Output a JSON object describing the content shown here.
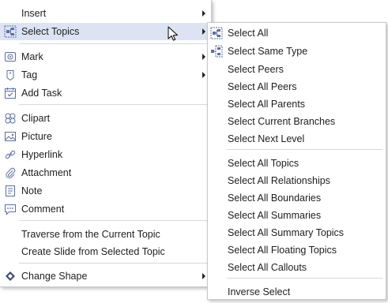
{
  "main_menu": {
    "insert": "Insert",
    "select_topics": "Select Topics",
    "mark": "Mark",
    "tag": "Tag",
    "add_task": "Add Task",
    "clipart": "Clipart",
    "picture": "Picture",
    "hyperlink": "Hyperlink",
    "attachment": "Attachment",
    "note": "Note",
    "comment": "Comment",
    "traverse": "Traverse from the Current Topic",
    "create_slide": "Create Slide from Selected Topic",
    "change_shape": "Change Shape"
  },
  "sub_menu": {
    "select_all": "Select All",
    "select_same_type": "Select Same Type",
    "select_peers": "Select Peers",
    "select_all_peers": "Select All Peers",
    "select_all_parents": "Select All Parents",
    "select_current_branches": "Select Current Branches",
    "select_next_level": "Select Next Level",
    "select_all_topics": "Select All Topics",
    "select_all_relationships": "Select All Relationships",
    "select_all_boundaries": "Select All Boundaries",
    "select_all_summaries": "Select All Summaries",
    "select_all_summary_topics": "Select All Summary Topics",
    "select_all_floating_topics": "Select All Floating Topics",
    "select_all_callouts": "Select All Callouts",
    "inverse_select": "Inverse Select"
  },
  "colors": {
    "highlight": "#dce4f3",
    "icon_blue": "#5b6fa8",
    "separator": "#d8d8d8"
  }
}
